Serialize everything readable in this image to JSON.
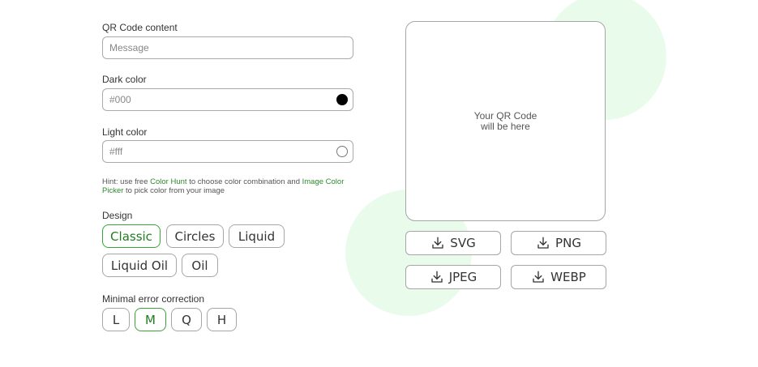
{
  "qr_content": {
    "label": "QR Code content",
    "placeholder": "Message"
  },
  "dark_color": {
    "label": "Dark color",
    "placeholder": "#000"
  },
  "light_color": {
    "label": "Light color",
    "placeholder": "#fff"
  },
  "hint": {
    "prefix": "Hint: use free ",
    "link1": "Color Hunt",
    "middle": " to choose color combination and ",
    "link2": "Image Color Picker",
    "suffix": " to pick color from your image"
  },
  "design": {
    "label": "Design",
    "options": [
      "Classic",
      "Circles",
      "Liquid",
      "Liquid Oil",
      "Oil"
    ],
    "selected": "Classic"
  },
  "error_correction": {
    "label": "Minimal error correction",
    "options": [
      "L",
      "M",
      "Q",
      "H"
    ],
    "selected": "M"
  },
  "preview": {
    "line1": "Your QR Code",
    "line2": "will be here"
  },
  "downloads": [
    "SVG",
    "PNG",
    "JPEG",
    "WEBP"
  ],
  "icons": {
    "download": "download-icon",
    "swatch": "color-swatch"
  },
  "colors": {
    "accent": "#37a537",
    "accent_text": "#207d20",
    "blob": "#e9fbea",
    "border": "#a6a6a6"
  }
}
